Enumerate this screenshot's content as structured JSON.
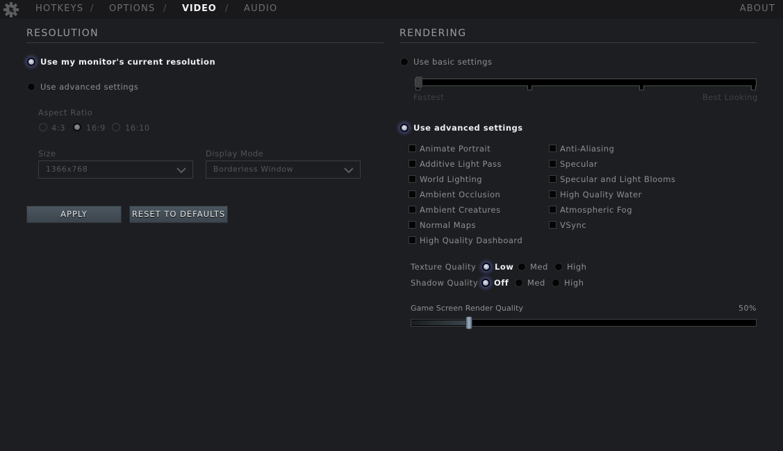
{
  "topbar": {
    "tabs": [
      {
        "label": "HOTKEYS",
        "active": false
      },
      {
        "label": "OPTIONS",
        "active": false
      },
      {
        "label": "VIDEO",
        "active": true
      },
      {
        "label": "AUDIO",
        "active": false
      }
    ],
    "separator": "/",
    "about": "ABOUT",
    "logo_icon": "gear-cursor-icon"
  },
  "resolution": {
    "title": "RESOLUTION",
    "mode_options": [
      {
        "label": "Use my monitor's current resolution",
        "selected": true
      },
      {
        "label": "Use advanced settings",
        "selected": false
      }
    ],
    "aspect_ratio": {
      "label": "Aspect Ratio",
      "options": [
        {
          "label": "4:3",
          "selected": false
        },
        {
          "label": "16:9",
          "selected": true
        },
        {
          "label": "16:10",
          "selected": false
        }
      ]
    },
    "size": {
      "label": "Size",
      "value": "1366x768"
    },
    "display_mode": {
      "label": "Display Mode",
      "value": "Borderless Window"
    },
    "apply_label": "APPLY",
    "reset_label": "RESET TO DEFAULTS"
  },
  "rendering": {
    "title": "RENDERING",
    "basic": {
      "label": "Use basic settings",
      "selected": false,
      "slider_min_label": "Fastest",
      "slider_max_label": "Best Looking",
      "slider_steps": 4,
      "slider_value_step": 0
    },
    "advanced": {
      "label": "Use advanced settings",
      "selected": true
    },
    "checkboxes_left": [
      {
        "label": "Animate Portrait",
        "checked": false
      },
      {
        "label": "Additive Light Pass",
        "checked": false
      },
      {
        "label": "World Lighting",
        "checked": false
      },
      {
        "label": "Ambient Occlusion",
        "checked": false
      },
      {
        "label": "Ambient Creatures",
        "checked": false
      },
      {
        "label": "Normal Maps",
        "checked": false
      },
      {
        "label": "High Quality Dashboard",
        "checked": false
      }
    ],
    "checkboxes_right": [
      {
        "label": "Anti-Aliasing",
        "checked": false
      },
      {
        "label": "Specular",
        "checked": false
      },
      {
        "label": "Specular and Light Blooms",
        "checked": false
      },
      {
        "label": "High Quality Water",
        "checked": false
      },
      {
        "label": "Atmospheric Fog",
        "checked": false
      },
      {
        "label": "VSync",
        "checked": false
      }
    ],
    "texture_quality": {
      "label": "Texture Quality",
      "options": [
        {
          "label": "Low",
          "selected": true
        },
        {
          "label": "Med",
          "selected": false
        },
        {
          "label": "High",
          "selected": false
        }
      ]
    },
    "shadow_quality": {
      "label": "Shadow Quality",
      "options": [
        {
          "label": "Off",
          "selected": true
        },
        {
          "label": "Med",
          "selected": false
        },
        {
          "label": "High",
          "selected": false
        }
      ]
    },
    "render_quality": {
      "label": "Game Screen Render Quality",
      "value_text": "50%",
      "value_percent": 50,
      "min_percent": 40,
      "max_percent": 100
    }
  }
}
